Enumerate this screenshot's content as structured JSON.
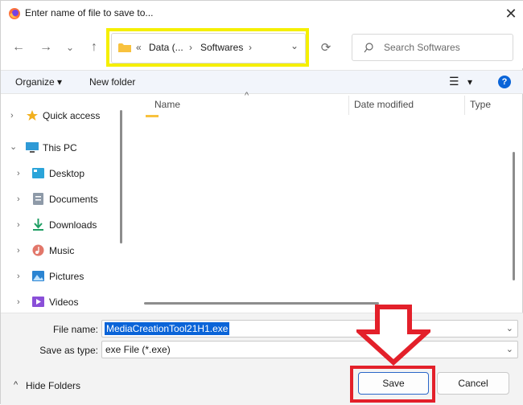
{
  "window": {
    "title": "Enter name of file to save to...",
    "close_label": "✕"
  },
  "nav": {
    "back": "←",
    "forward": "→",
    "recent": "⌄",
    "up": "↑",
    "refresh": "⟳"
  },
  "address": {
    "overflow": "«",
    "segment1": "Data (...",
    "sep1": "›",
    "segment2": "Softwares",
    "sep2": "›",
    "dropdown": "⌄"
  },
  "search": {
    "placeholder": "Search Softwares"
  },
  "toolbar": {
    "organize": "Organize ▾",
    "new_folder": "New folder",
    "view": "☰",
    "view_dropdown": "▾",
    "help": "?"
  },
  "sidebar": {
    "items": [
      {
        "label": "Quick access",
        "icon": "star-icon",
        "chevron": "›"
      },
      {
        "label": "This PC",
        "icon": "pc-icon",
        "chevron": "⌄"
      },
      {
        "label": "Desktop",
        "icon": "desktop-icon",
        "chevron": "›"
      },
      {
        "label": "Documents",
        "icon": "documents-icon",
        "chevron": "›"
      },
      {
        "label": "Downloads",
        "icon": "download-icon",
        "chevron": "›"
      },
      {
        "label": "Music",
        "icon": "music-icon",
        "chevron": "›"
      },
      {
        "label": "Pictures",
        "icon": "pictures-icon",
        "chevron": "›"
      },
      {
        "label": "Videos",
        "icon": "videos-icon",
        "chevron": "›"
      }
    ]
  },
  "file_list": {
    "sort_indicator": "^",
    "columns": [
      "Name",
      "Date modified",
      "Type"
    ]
  },
  "form": {
    "file_name_label": "File name:",
    "file_name_value": "MediaCreationTool21H1.exe",
    "save_as_label": "Save as type:",
    "save_as_value": "exe File (*.exe)",
    "dropdown": "⌄"
  },
  "footer": {
    "hide_folders": "Hide Folders",
    "hide_chevron": "^",
    "save": "Save",
    "cancel": "Cancel"
  },
  "colors": {
    "highlight_yellow": "#f5ef00",
    "highlight_red": "#e3202a",
    "accent": "#0a64d8"
  }
}
